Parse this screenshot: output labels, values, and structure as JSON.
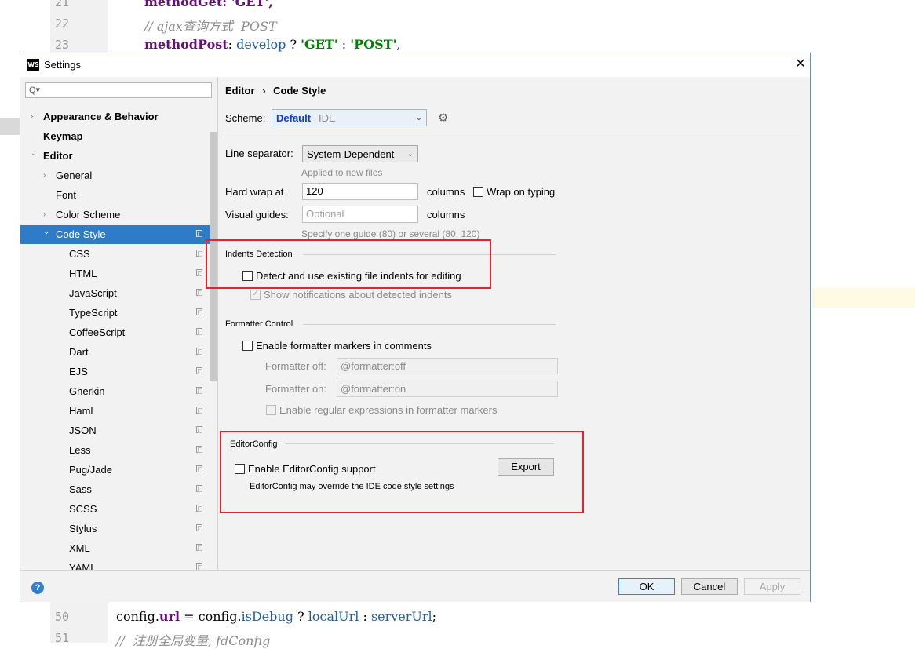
{
  "editor_bg": {
    "lines_top": [
      {
        "num": "21",
        "code": "methodGet: 'GET',"
      },
      {
        "num": "22",
        "comment": "// ajax查询方式  POST"
      },
      {
        "num": "23",
        "key": "methodPost",
        "colon": ":",
        "develop": "develop",
        "q": "?",
        "s1": "'GET'",
        "c": ":",
        "s2": "'POST'",
        "comma": ","
      }
    ],
    "lines_bottom": [
      {
        "num": "50",
        "obj": "config",
        "dot": ".",
        "prop": "url",
        "eq": "=",
        "obj2": "config",
        "dot2": ".",
        "prop2": "isDebug",
        "q": "?",
        "v1": "localUrl",
        "c": ":",
        "v2": "serverUrl",
        "semi": ";"
      },
      {
        "num": "51",
        "comment": "//  注册全局变量, fdConfig"
      }
    ]
  },
  "dialog": {
    "title": "Settings",
    "logo": "WS",
    "close": "✕"
  },
  "sidebar": {
    "search_icon": "Q▾",
    "items": [
      {
        "label": "Appearance & Behavior",
        "bold": true,
        "arrow": "›"
      },
      {
        "label": "Keymap",
        "bold": true,
        "arrow": ""
      },
      {
        "label": "Editor",
        "bold": true,
        "arrow": "⌄"
      },
      {
        "label": "General",
        "arrow": "›"
      },
      {
        "label": "Font",
        "arrow": ""
      },
      {
        "label": "Color Scheme",
        "arrow": "›"
      },
      {
        "label": "Code Style",
        "arrow": "⌄",
        "selected": true
      },
      {
        "label": "CSS"
      },
      {
        "label": "HTML"
      },
      {
        "label": "JavaScript"
      },
      {
        "label": "TypeScript"
      },
      {
        "label": "CoffeeScript"
      },
      {
        "label": "Dart"
      },
      {
        "label": "EJS"
      },
      {
        "label": "Gherkin"
      },
      {
        "label": "Haml"
      },
      {
        "label": "JSON"
      },
      {
        "label": "Less"
      },
      {
        "label": "Pug/Jade"
      },
      {
        "label": "Sass"
      },
      {
        "label": "SCSS"
      },
      {
        "label": "Stylus"
      },
      {
        "label": "XML"
      },
      {
        "label": "YAML"
      }
    ]
  },
  "breadcrumb": {
    "part1": "Editor",
    "sep": "›",
    "part2": "Code Style"
  },
  "scheme": {
    "label": "Scheme:",
    "name": "Default",
    "type": "IDE"
  },
  "line_separator": {
    "label": "Line separator:",
    "value": "System-Dependent",
    "hint": "Applied to new files"
  },
  "hard_wrap": {
    "label": "Hard wrap at",
    "value": "120",
    "unit": "columns",
    "wrap_label": "Wrap on typing"
  },
  "visual_guides": {
    "label": "Visual guides:",
    "placeholder": "Optional",
    "unit": "columns",
    "hint": "Specify one guide (80) or several (80, 120)"
  },
  "indents": {
    "title": "Indents Detection",
    "detect_label": "Detect and use existing file indents for editing",
    "notify_label": "Show notifications about detected indents"
  },
  "formatter": {
    "title": "Formatter Control",
    "enable_label": "Enable formatter markers in comments",
    "off_label": "Formatter off:",
    "off_value": "@formatter:off",
    "on_label": "Formatter on:",
    "on_value": "@formatter:on",
    "regex_label": "Enable regular expressions in formatter markers"
  },
  "editorconfig": {
    "title": "EditorConfig",
    "enable_label": "Enable EditorConfig support",
    "note": "EditorConfig may override the IDE code style settings",
    "export": "Export"
  },
  "buttons": {
    "help": "?",
    "ok": "OK",
    "cancel": "Cancel",
    "apply": "Apply"
  },
  "colors": {
    "selection": "#2e7cc8",
    "highlight": "#e0242a",
    "scheme_name": "#0b3fd6"
  }
}
